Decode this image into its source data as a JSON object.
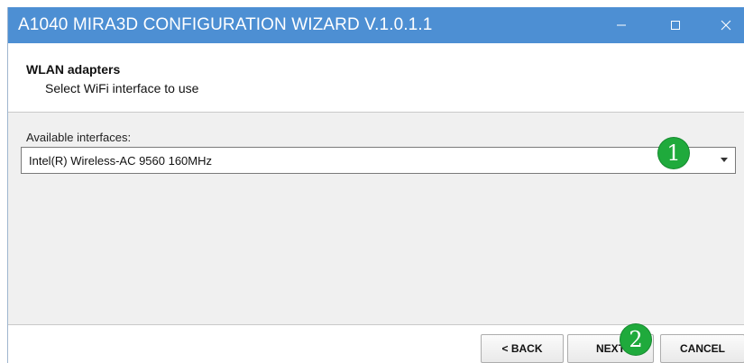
{
  "window": {
    "title": "A1040 MIRA3D CONFIGURATION WIZARD V.1.0.1.1",
    "controls": {
      "minimize": "—",
      "maximize": "☐",
      "close": "✕"
    },
    "titlebar_color": "#4d8fd3"
  },
  "header": {
    "title": "WLAN adapters",
    "subtitle": "Select WiFi interface to use"
  },
  "content": {
    "interfaces_label": "Available interfaces:",
    "selected_interface": "Intel(R) Wireless-AC 9560 160MHz"
  },
  "annotations": {
    "step1": "1",
    "step2": "2",
    "badge_color": "#1faa3c"
  },
  "footer": {
    "back_label": "< BACK",
    "next_label": "NEXT",
    "cancel_label": "CANCEL"
  }
}
